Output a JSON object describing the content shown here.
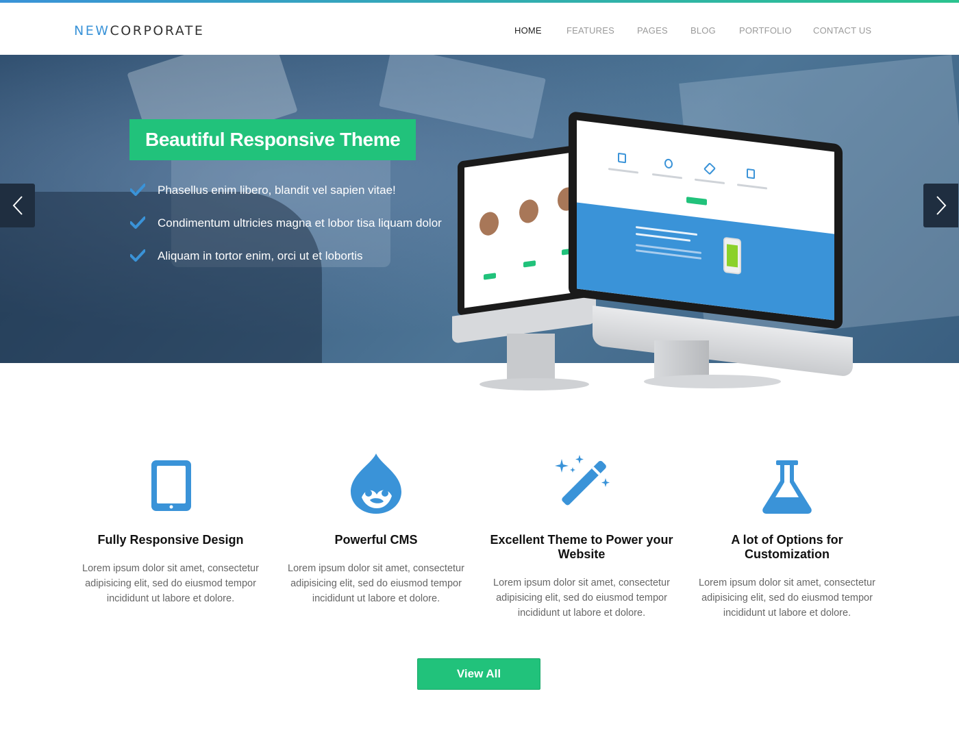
{
  "header": {
    "logo_part1": "NEW",
    "logo_part2": "CORPORATE",
    "nav": [
      "HOME",
      "FEATURES",
      "PAGES",
      "BLOG",
      "PORTFOLIO",
      "CONTACT US"
    ],
    "active_nav": "HOME"
  },
  "hero": {
    "title": "Beautiful Responsive Theme",
    "bullets": [
      "Phasellus enim libero, blandit vel sapien vitae!",
      "Condimentum ultricies magna et lobor tisa liquam dolor",
      "Aliquam in tortor enim, orci ut et lobortis"
    ],
    "prev_icon": "chevron-left-icon",
    "next_icon": "chevron-right-icon"
  },
  "features": [
    {
      "icon": "tablet-icon",
      "title": "Fully Responsive Design",
      "text": "Lorem ipsum dolor sit amet, consectetur adipisicing elit, sed do eiusmod tempor incididunt ut labore et dolore."
    },
    {
      "icon": "drupal-icon",
      "title": "Powerful CMS",
      "text": "Lorem ipsum dolor sit amet, consectetur adipisicing elit, sed do eiusmod tempor incididunt ut labore et dolore."
    },
    {
      "icon": "magic-wand-icon",
      "title": "Excellent Theme to Power your Website",
      "text": "Lorem ipsum dolor sit amet, consectetur adipisicing elit, sed do eiusmod tempor incididunt ut labore et dolore."
    },
    {
      "icon": "flask-icon",
      "title": "A lot of Options for Customization",
      "text": "Lorem ipsum dolor sit amet, consectetur adipisicing elit, sed do eiusmod tempor incididunt ut labore et dolore."
    }
  ],
  "view_all_label": "View All",
  "colors": {
    "accent_blue": "#3a93d8",
    "accent_green": "#21c27b",
    "nav_inactive": "#9a9a9a",
    "body_text": "#666666"
  }
}
